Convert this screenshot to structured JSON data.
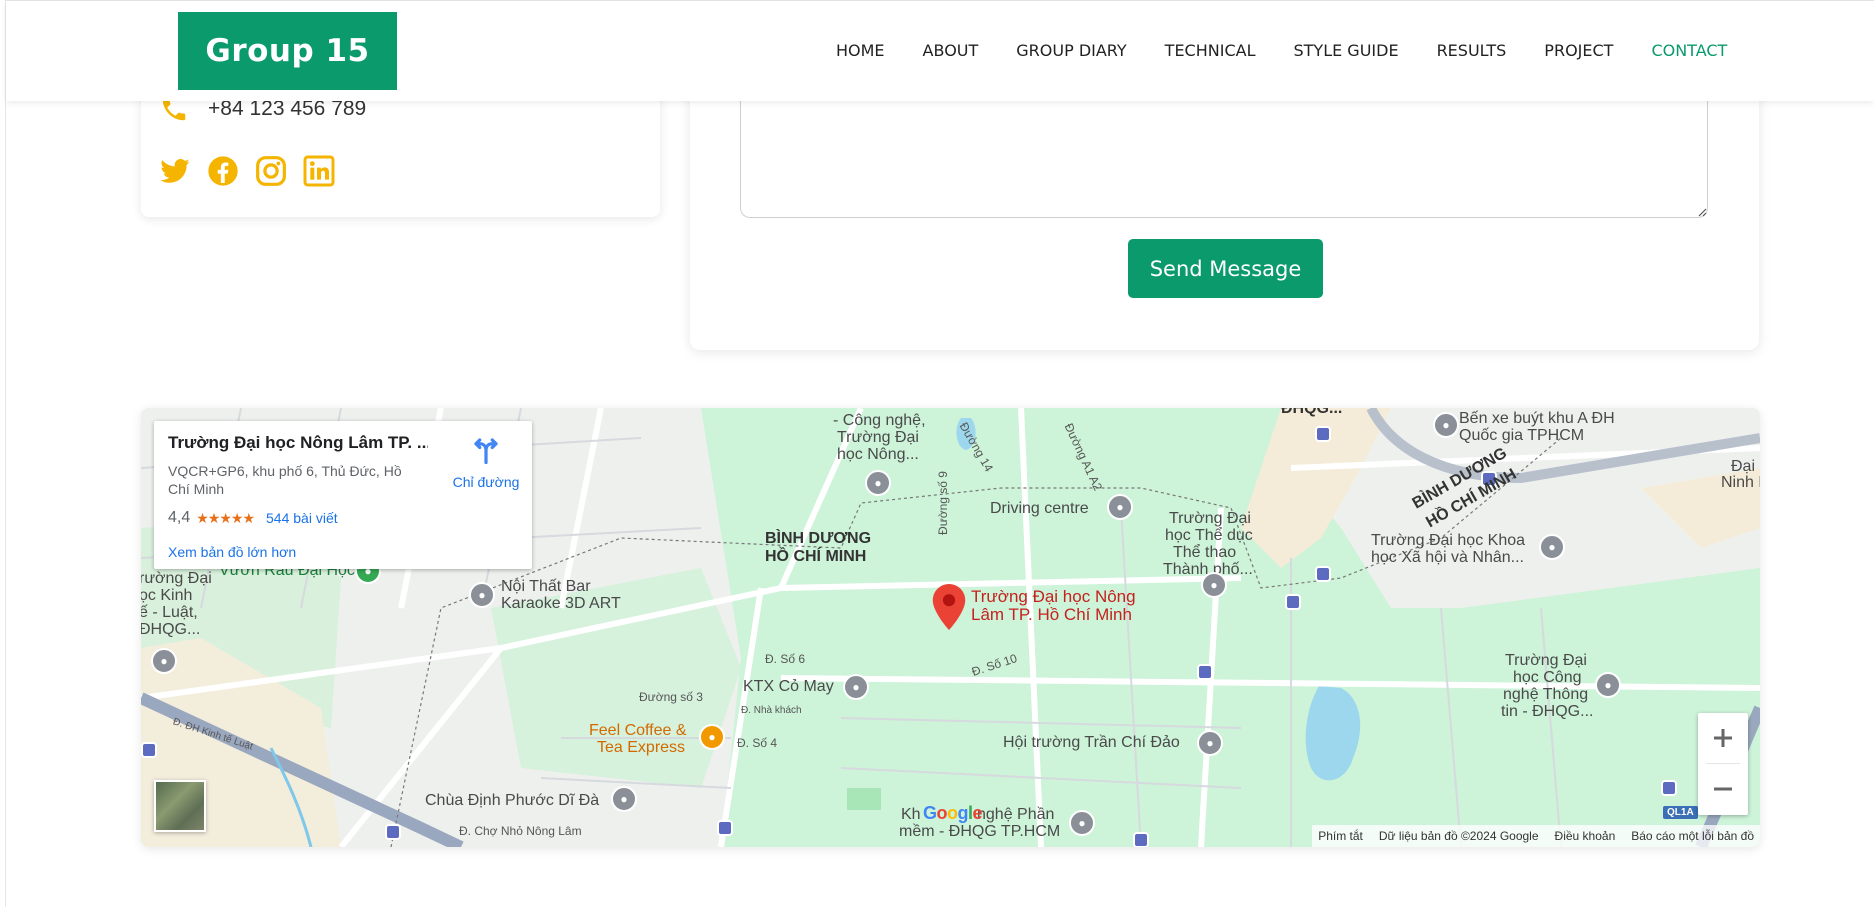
{
  "brand": {
    "logo_text": "Group 15",
    "accent": "#0a9a6c"
  },
  "nav": {
    "items": [
      {
        "label": "HOME"
      },
      {
        "label": "ABOUT"
      },
      {
        "label": "GROUP DIARY"
      },
      {
        "label": "TECHNICAL"
      },
      {
        "label": "STYLE GUIDE"
      },
      {
        "label": "RESULTS"
      },
      {
        "label": "PROJECT"
      },
      {
        "label": "CONTACT"
      }
    ],
    "active": "CONTACT"
  },
  "contact": {
    "phone": "+84 123 456 789",
    "icon_color": "#f4b400",
    "socials": [
      "twitter-icon",
      "facebook-icon",
      "instagram-icon",
      "linkedin-icon"
    ]
  },
  "form": {
    "message_value": "",
    "send_label": "Send Message"
  },
  "map": {
    "place": {
      "name": "Trường Đại học Nông Lâm TP. ...",
      "address": "VQCR+GP6, khu phố 6, Thủ Đức, Hồ Chí Minh",
      "rating": "4,4",
      "stars": "★★★★★",
      "reviews": "544 bài viết",
      "larger_map": "Xem bản đồ lớn hơn",
      "directions": "Chỉ đường"
    },
    "pin_label_1": "Trường Đại học Nông",
    "pin_label_2": "Lâm TP. Hồ Chí Minh",
    "labels": {
      "cong_nghe": "- Công nghệ,",
      "truong_dai": "Trường Đại",
      "hoc_nong": "học Nông...",
      "duong14": "Đường 14",
      "duong_a1a2": "Đường A1 A2",
      "dhqg_top": "ĐHQG...",
      "ben_xe_1": "Bến xe buýt khu A ĐH",
      "ben_xe_2": "Quốc gia TPHCM",
      "dai": "Đại",
      "ninh": "Ninh N",
      "duong_so_9": "Đường số 9",
      "driving_centre": "Driving centre",
      "td_the_duc_1": "Trường Đại",
      "td_the_duc_2": "học Thể dục",
      "td_the_duc_3": "Thể thao",
      "td_the_duc_4": "Thành phố...",
      "binh_duong_right": "BÌNH DƯƠNG",
      "hcm_right": "HỒ CHÍ MINH",
      "td_khoa_1": "Trường Đại học Khoa",
      "td_khoa_2": "học Xã hội và Nhân...",
      "binh_duong": "BÌNH DƯƠNG",
      "hcm": "HỒ CHÍ MINH",
      "vuon_rau": "Vườn Rau Đại Học",
      "noi_that_1": "Nội Thất Bar",
      "noi_that_2": "Karaoke 3D ART",
      "kinh_te_1": "rường Đại",
      "kinh_te_2": "ọc Kinh",
      "kinh_te_3": "ế - Luật,",
      "kinh_te_4": "ĐHQG...",
      "d_so_6": "Đ. Số 6",
      "d_so_10": "Đ. Số 10",
      "ktx": "KTX Cỏ May",
      "duong_so_3": "Đường số 3",
      "nha_khach": "Đ. Nhà khách",
      "feel_coffee_1": "Feel Coffee &",
      "feel_coffee_2": "Tea Express",
      "d_so_4": "Đ. Số 4",
      "d_kinh_te_luat": "Đ. ĐH Kinh tế Luật",
      "hoi_truong": "Hội trường Trần Chí Đảo",
      "cntt_1": "Trường Đại",
      "cntt_2": "học Công",
      "cntt_3": "nghệ Thông",
      "cntt_4": "tin - ĐHQG...",
      "chua": "Chùa Định Phước Dĩ Đà",
      "cho_nho": "Đ. Chợ Nhỏ Nông Lâm",
      "kh_1": "Kh",
      "kh_2": "nghệ Phần",
      "kh_3": "mềm - ĐHQG TP.HCM",
      "ql1a": "QL1A"
    },
    "attribution": [
      "Phím tắt",
      "Dữ liệu bản đồ ©2024 Google",
      "Điều khoản",
      "Báo cáo một lỗi bản đồ"
    ],
    "google": "Google"
  }
}
